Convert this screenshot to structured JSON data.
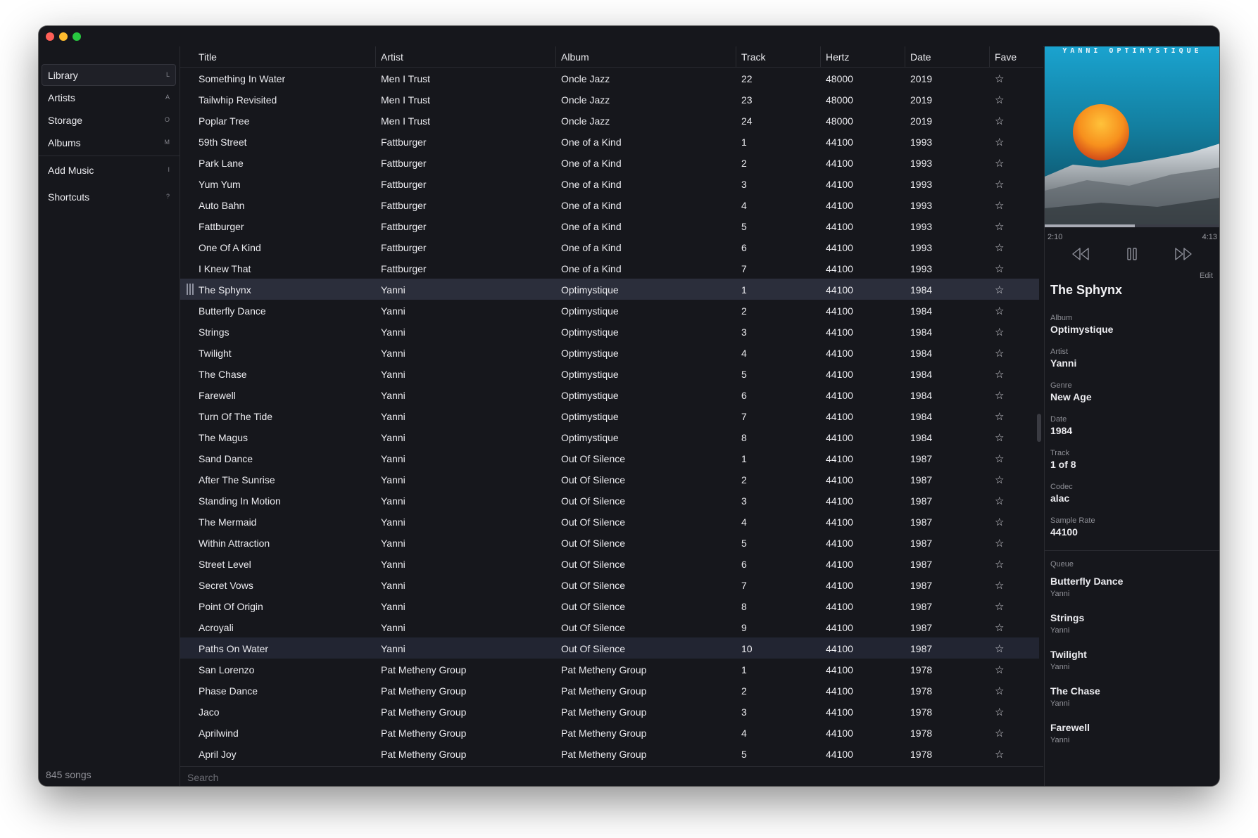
{
  "sidebar": {
    "items": [
      {
        "label": "Library",
        "key": "L"
      },
      {
        "label": "Artists",
        "key": "A"
      },
      {
        "label": "Storage",
        "key": "O"
      },
      {
        "label": "Albums",
        "key": "M"
      },
      {
        "label": "Add Music",
        "key": "I"
      },
      {
        "label": "Shortcuts",
        "key": "?"
      }
    ],
    "song_count": "845 songs"
  },
  "table": {
    "columns": [
      "Title",
      "Artist",
      "Album",
      "Track",
      "Hertz",
      "Date",
      "Fave"
    ],
    "rows": [
      {
        "title": "Something In Water",
        "artist": "Men I Trust",
        "album": "Oncle Jazz",
        "track": "22",
        "hertz": "48000",
        "date": "2019",
        "fave": "☆"
      },
      {
        "title": "Tailwhip Revisited",
        "artist": "Men I Trust",
        "album": "Oncle Jazz",
        "track": "23",
        "hertz": "48000",
        "date": "2019",
        "fave": "☆"
      },
      {
        "title": "Poplar Tree",
        "artist": "Men I Trust",
        "album": "Oncle Jazz",
        "track": "24",
        "hertz": "48000",
        "date": "2019",
        "fave": "☆"
      },
      {
        "title": "59th Street",
        "artist": "Fattburger",
        "album": "One of a Kind",
        "track": "1",
        "hertz": "44100",
        "date": "1993",
        "fave": "☆"
      },
      {
        "title": "Park Lane",
        "artist": "Fattburger",
        "album": "One of a Kind",
        "track": "2",
        "hertz": "44100",
        "date": "1993",
        "fave": "☆"
      },
      {
        "title": "Yum Yum",
        "artist": "Fattburger",
        "album": "One of a Kind",
        "track": "3",
        "hertz": "44100",
        "date": "1993",
        "fave": "☆"
      },
      {
        "title": "Auto Bahn",
        "artist": "Fattburger",
        "album": "One of a Kind",
        "track": "4",
        "hertz": "44100",
        "date": "1993",
        "fave": "☆"
      },
      {
        "title": "Fattburger",
        "artist": "Fattburger",
        "album": "One of a Kind",
        "track": "5",
        "hertz": "44100",
        "date": "1993",
        "fave": "☆"
      },
      {
        "title": "One Of A Kind",
        "artist": "Fattburger",
        "album": "One of a Kind",
        "track": "6",
        "hertz": "44100",
        "date": "1993",
        "fave": "☆"
      },
      {
        "title": "I Knew That",
        "artist": "Fattburger",
        "album": "One of a Kind",
        "track": "7",
        "hertz": "44100",
        "date": "1993",
        "fave": "☆"
      },
      {
        "title": "The Sphynx",
        "artist": "Yanni",
        "album": "Optimystique",
        "track": "1",
        "hertz": "44100",
        "date": "1984",
        "fave": "☆"
      },
      {
        "title": "Butterfly Dance",
        "artist": "Yanni",
        "album": "Optimystique",
        "track": "2",
        "hertz": "44100",
        "date": "1984",
        "fave": "☆"
      },
      {
        "title": "Strings",
        "artist": "Yanni",
        "album": "Optimystique",
        "track": "3",
        "hertz": "44100",
        "date": "1984",
        "fave": "☆"
      },
      {
        "title": "Twilight",
        "artist": "Yanni",
        "album": "Optimystique",
        "track": "4",
        "hertz": "44100",
        "date": "1984",
        "fave": "☆"
      },
      {
        "title": "The Chase",
        "artist": "Yanni",
        "album": "Optimystique",
        "track": "5",
        "hertz": "44100",
        "date": "1984",
        "fave": "☆"
      },
      {
        "title": "Farewell",
        "artist": "Yanni",
        "album": "Optimystique",
        "track": "6",
        "hertz": "44100",
        "date": "1984",
        "fave": "☆"
      },
      {
        "title": "Turn Of The Tide",
        "artist": "Yanni",
        "album": "Optimystique",
        "track": "7",
        "hertz": "44100",
        "date": "1984",
        "fave": "☆"
      },
      {
        "title": "The Magus",
        "artist": "Yanni",
        "album": "Optimystique",
        "track": "8",
        "hertz": "44100",
        "date": "1984",
        "fave": "☆"
      },
      {
        "title": "Sand Dance",
        "artist": "Yanni",
        "album": "Out Of Silence",
        "track": "1",
        "hertz": "44100",
        "date": "1987",
        "fave": "☆"
      },
      {
        "title": "After The Sunrise",
        "artist": "Yanni",
        "album": "Out Of Silence",
        "track": "2",
        "hertz": "44100",
        "date": "1987",
        "fave": "☆"
      },
      {
        "title": "Standing In Motion",
        "artist": "Yanni",
        "album": "Out Of Silence",
        "track": "3",
        "hertz": "44100",
        "date": "1987",
        "fave": "☆"
      },
      {
        "title": "The Mermaid",
        "artist": "Yanni",
        "album": "Out Of Silence",
        "track": "4",
        "hertz": "44100",
        "date": "1987",
        "fave": "☆"
      },
      {
        "title": "Within Attraction",
        "artist": "Yanni",
        "album": "Out Of Silence",
        "track": "5",
        "hertz": "44100",
        "date": "1987",
        "fave": "☆"
      },
      {
        "title": "Street Level",
        "artist": "Yanni",
        "album": "Out Of Silence",
        "track": "6",
        "hertz": "44100",
        "date": "1987",
        "fave": "☆"
      },
      {
        "title": "Secret Vows",
        "artist": "Yanni",
        "album": "Out Of Silence",
        "track": "7",
        "hertz": "44100",
        "date": "1987",
        "fave": "☆"
      },
      {
        "title": "Point Of Origin",
        "artist": "Yanni",
        "album": "Out Of Silence",
        "track": "8",
        "hertz": "44100",
        "date": "1987",
        "fave": "☆"
      },
      {
        "title": "Acroyali",
        "artist": "Yanni",
        "album": "Out Of Silence",
        "track": "9",
        "hertz": "44100",
        "date": "1987",
        "fave": "☆"
      },
      {
        "title": "Paths On Water",
        "artist": "Yanni",
        "album": "Out Of Silence",
        "track": "10",
        "hertz": "44100",
        "date": "1987",
        "fave": "☆"
      },
      {
        "title": "San Lorenzo",
        "artist": "Pat Metheny Group",
        "album": "Pat Metheny Group",
        "track": "1",
        "hertz": "44100",
        "date": "1978",
        "fave": "☆"
      },
      {
        "title": "Phase Dance",
        "artist": "Pat Metheny Group",
        "album": "Pat Metheny Group",
        "track": "2",
        "hertz": "44100",
        "date": "1978",
        "fave": "☆"
      },
      {
        "title": "Jaco",
        "artist": "Pat Metheny Group",
        "album": "Pat Metheny Group",
        "track": "3",
        "hertz": "44100",
        "date": "1978",
        "fave": "☆"
      },
      {
        "title": "Aprilwind",
        "artist": "Pat Metheny Group",
        "album": "Pat Metheny Group",
        "track": "4",
        "hertz": "44100",
        "date": "1978",
        "fave": "☆"
      },
      {
        "title": "April Joy",
        "artist": "Pat Metheny Group",
        "album": "Pat Metheny Group",
        "track": "5",
        "hertz": "44100",
        "date": "1978",
        "fave": "☆"
      }
    ],
    "playing_index": 10,
    "selected_index": 27
  },
  "search": {
    "placeholder": "Search",
    "value": ""
  },
  "now_playing": {
    "album_art_text": "YANNI OPTIMYSTIQUE",
    "elapsed": "2:10",
    "duration": "4:13",
    "progress": 0.514,
    "edit_label": "Edit",
    "title": "The Sphynx",
    "meta": [
      {
        "key": "Album",
        "value": "Optimystique"
      },
      {
        "key": "Artist",
        "value": "Yanni"
      },
      {
        "key": "Genre",
        "value": "New Age"
      },
      {
        "key": "Date",
        "value": "1984"
      },
      {
        "key": "Track",
        "value": "1 of 8"
      },
      {
        "key": "Codec",
        "value": "alac"
      },
      {
        "key": "Sample Rate",
        "value": "44100"
      }
    ],
    "controls": {
      "prev_icon": "rewind-icon",
      "play_icon": "pause-icon",
      "next_icon": "fast-forward-icon"
    }
  },
  "queue": {
    "heading": "Queue",
    "items": [
      {
        "title": "Butterfly Dance",
        "artist": "Yanni"
      },
      {
        "title": "Strings",
        "artist": "Yanni"
      },
      {
        "title": "Twilight",
        "artist": "Yanni"
      },
      {
        "title": "The Chase",
        "artist": "Yanni"
      },
      {
        "title": "Farewell",
        "artist": "Yanni"
      }
    ]
  },
  "colors": {
    "window_bg": "#16171c",
    "playing_row": "#2b2e3b",
    "selected_row": "#222532",
    "traffic_red": "#fe5f57",
    "traffic_yellow": "#febc2e",
    "traffic_green": "#28c840"
  }
}
